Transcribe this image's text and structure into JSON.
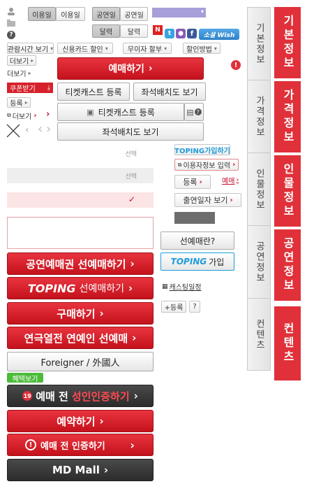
{
  "toggles": {
    "date_on": "이용일",
    "date_off": "이용일",
    "perf_on": "공연일",
    "perf_off": "공연일",
    "cal_on": "달력",
    "cal_off": "달력"
  },
  "sns": {
    "social_wish": "소셜 Wish"
  },
  "filters": {
    "viewing_time": "관람시간 보기",
    "card_discount": "신용카드 할인",
    "installment": "무이자 할부",
    "discount_method": "할인방법"
  },
  "links": {
    "more1": "더보기",
    "more2": "더보기",
    "register": "등록",
    "more3": "더보기"
  },
  "coupon": {
    "label": "쿠폰받기"
  },
  "main": {
    "reserve": "예매하기",
    "ticketcast_register": "티켓캐스트 등록",
    "seat_view": "좌석배치도 보기",
    "ticketcast_register2": "티켓캐스트 등록",
    "seat_view2": "좌석배치도 보기"
  },
  "selects": {
    "select1": "선택",
    "select2": "선택"
  },
  "side": {
    "toping_join_small": "TOPING가입하기",
    "user_info": "이용자정보 입력",
    "register": "등록",
    "reserve_link": "예매",
    "appearance_date": "출연일자 보기",
    "pre_sale_q": "선예매란?",
    "toping_join": "가입",
    "casting_schedule": "캐스팅일정",
    "plus_register": "+등록",
    "help": "?"
  },
  "big_buttons": {
    "ticket_presale": "공연예매권 선예매하기",
    "toping_presale": "선예매하기",
    "purchase": "구매하기",
    "celebrity_presale": "연극열전 연예인 선예매",
    "foreigner": "Foreigner / 外國人",
    "benefit": "혜택보기",
    "adult_prefix": "예매 전",
    "adult_highlight": "성인인증하기",
    "adult_badge": "19",
    "booking": "예약하기",
    "verify": "예매 전 인증하기",
    "md_mall": "MD Mall"
  },
  "brand": {
    "toping": "TOPING"
  },
  "tabs_grey": [
    "기본정보",
    "가격정보",
    "인물정보",
    "공연정보",
    "컨텐츠"
  ],
  "tabs_red": [
    "기본정보",
    "가격정보",
    "인물정보",
    "공연정보",
    "컨텐츠"
  ],
  "colors": {
    "accent_red": "#e0313a",
    "toping_blue": "#1e9bd7",
    "purple_select": "#a79fd9"
  }
}
